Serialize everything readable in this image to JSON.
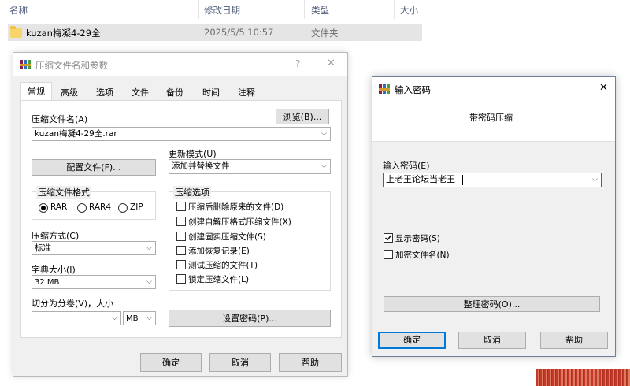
{
  "explorer": {
    "columns": {
      "name": "名称",
      "modified": "修改日期",
      "type": "类型",
      "size": "大小"
    },
    "file": {
      "name": "kuzan梅凝4-29全",
      "modified": "2025/5/5 10:57",
      "type": "文件夹"
    }
  },
  "archive_dialog": {
    "title": "压缩文件名和参数",
    "help_glyph": "?",
    "close_glyph": "✕",
    "tabs": [
      "常规",
      "高级",
      "选项",
      "文件",
      "备份",
      "时间",
      "注释"
    ],
    "archive_name_label": "压缩文件名(A)",
    "browse_button": "浏览(B)...",
    "archive_name_value": "kuzan梅凝4-29全.rar",
    "update_mode_label": "更新模式(U)",
    "update_mode_value": "添加并替换文件",
    "profiles_button": "配置文件(F)...",
    "format_group": "压缩文件格式",
    "formats": [
      "RAR",
      "RAR4",
      "ZIP"
    ],
    "selected_format": "RAR",
    "options_group": "压缩选项",
    "options": [
      "压缩后删除原来的文件(D)",
      "创建自解压格式压缩文件(X)",
      "创建固实压缩文件(S)",
      "添加恢复记录(E)",
      "测试压缩的文件(T)",
      "锁定压缩文件(L)"
    ],
    "method_label": "压缩方式(C)",
    "method_value": "标准",
    "dict_label": "字典大小(I)",
    "dict_value": "32 MB",
    "split_label": "切分为分卷(V)，大小",
    "split_value": "",
    "split_unit": "MB",
    "set_password_button": "设置密码(P)...",
    "ok_button": "确定",
    "cancel_button": "取消",
    "help_button": "帮助"
  },
  "password_dialog": {
    "title": "输入密码",
    "close_glyph": "✕",
    "header": "带密码压缩",
    "password_label": "输入密码(E)",
    "password_value": "上老王论坛当老王",
    "show_password": "显示密码(S)",
    "show_password_checked": true,
    "encrypt_names": "加密文件名(N)",
    "encrypt_names_checked": false,
    "organize_button": "整理密码(O)...",
    "ok_button": "确定",
    "cancel_button": "取消",
    "help_button": "帮助"
  },
  "colors": {
    "accent": "#0078d7",
    "selection_bg": "#e5e5e5",
    "dialog_bg": "#f0f0f0"
  }
}
